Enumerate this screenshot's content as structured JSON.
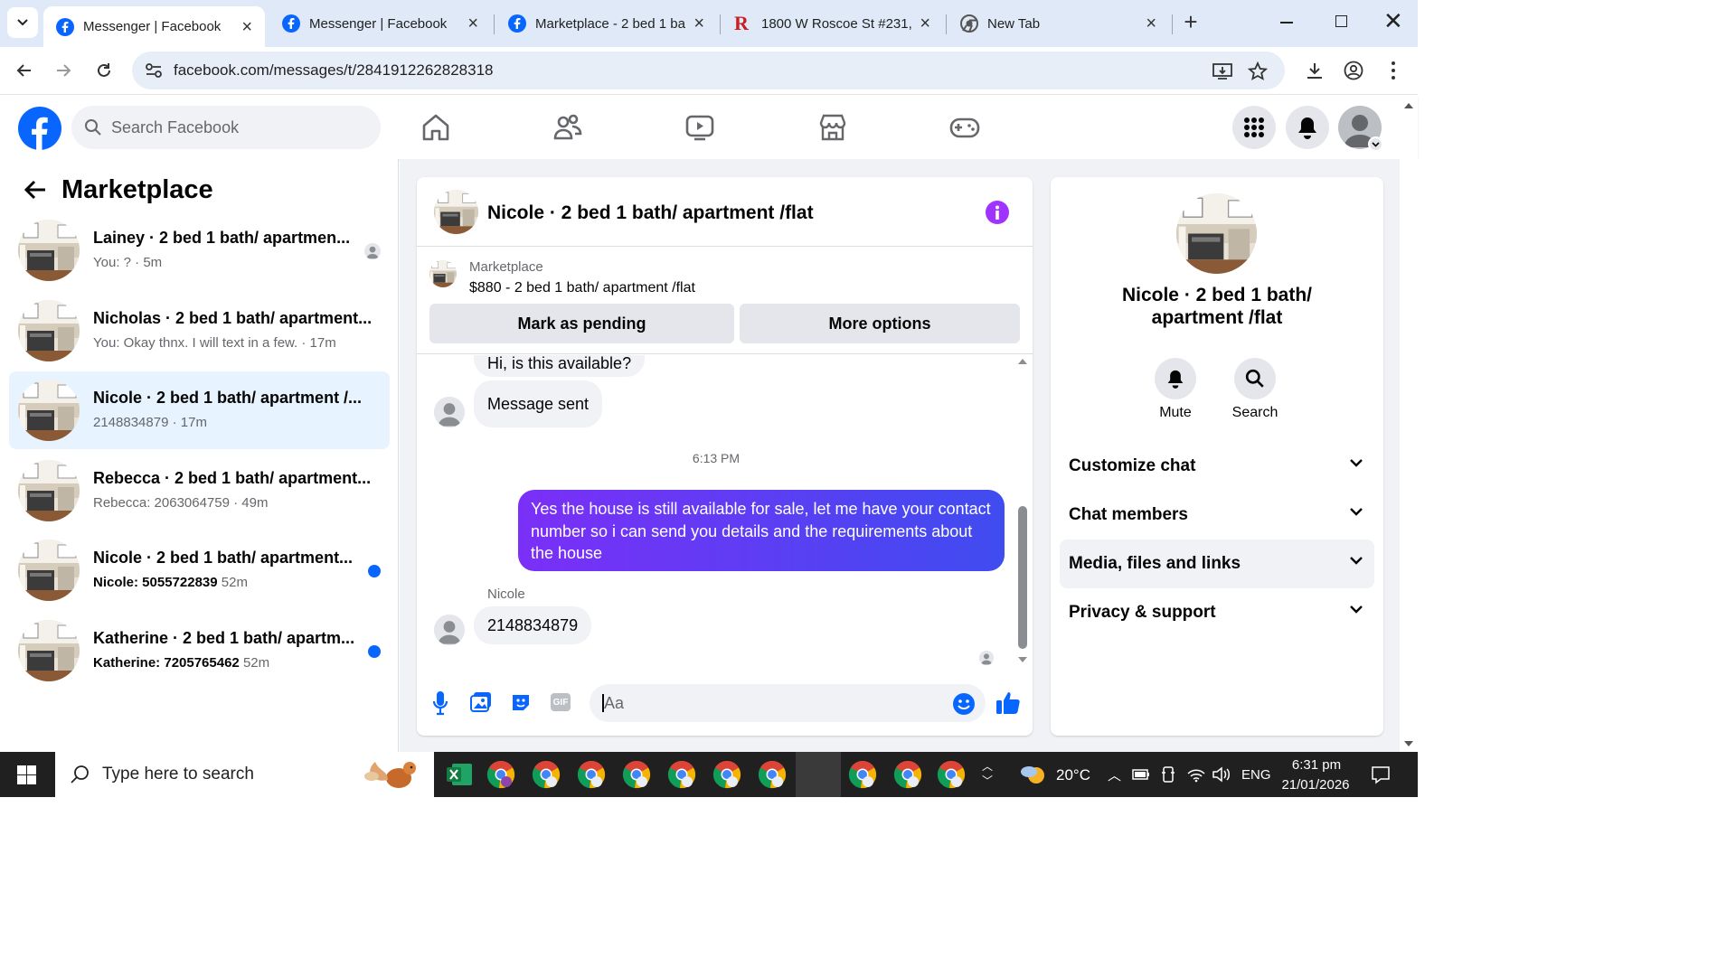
{
  "browser": {
    "tabs": [
      {
        "title": "Messenger | Facebook",
        "active": true,
        "icon": "facebook-icon"
      },
      {
        "title": "Messenger | Facebook",
        "active": false,
        "icon": "facebook-icon"
      },
      {
        "title": "Marketplace - 2 bed 1 ba",
        "active": false,
        "icon": "facebook-icon"
      },
      {
        "title": "1800 W Roscoe St #231, (",
        "active": false,
        "icon": "redfin-icon"
      },
      {
        "title": "New Tab",
        "active": false,
        "icon": "chrome-icon"
      }
    ],
    "url": "facebook.com/messages/t/2841912262828318"
  },
  "facebook": {
    "search_placeholder": "Search Facebook",
    "brand_color": "#0866ff"
  },
  "sidebar": {
    "title": "Marketplace",
    "conversations": [
      {
        "name": "Lainey · 2 bed 1 bath/ apartmen...",
        "preview": "You: ? · 5m",
        "unread": false,
        "selected": false,
        "status": "seen-avatar"
      },
      {
        "name": "Nicholas · 2 bed 1 bath/ apartment...",
        "preview": "You: Okay thnx. I will text in a few. · 17m",
        "unread": false,
        "selected": false,
        "status": ""
      },
      {
        "name": "Nicole · 2 bed 1 bath/ apartment /...",
        "preview": "2148834879 · 17m",
        "unread": false,
        "selected": true,
        "status": ""
      },
      {
        "name": "Rebecca · 2 bed 1 bath/ apartment...",
        "preview": "Rebecca: 2063064759 · 49m",
        "unread": false,
        "selected": false,
        "status": ""
      },
      {
        "name": "Nicole · 2 bed 1 bath/ apartment...",
        "preview": "Nicole: 5055722839",
        "time": "52m",
        "unread": true,
        "selected": false,
        "status": "unread-dot"
      },
      {
        "name": "Katherine · 2 bed 1 bath/ apartm...",
        "preview": "Katherine: 7205765462",
        "time": "52m",
        "unread": true,
        "selected": false,
        "status": "unread-dot"
      }
    ]
  },
  "chat": {
    "header_title": "Nicole · 2 bed 1 bath/ apartment /flat",
    "listing": {
      "label": "Marketplace",
      "title": "$880 - 2 bed 1 bath/ apartment /flat",
      "mark_pending": "Mark as pending",
      "more_options": "More options"
    },
    "messages": {
      "partial_incoming": "Hi, is this available?",
      "system": "Message sent",
      "timestamp": "6:13 PM",
      "outgoing": "Yes the house is still available for sale, let me have your contact number so i can send you details and the requirements about the house",
      "sender_name": "Nicole",
      "incoming": "2148834879"
    },
    "composer_placeholder": "Aa",
    "accent_gradient_start": "#7b2ff7",
    "accent_gradient_end": "#3f4cf0"
  },
  "details": {
    "name": "Nicole · 2 bed 1 bath/ apartment /flat",
    "mute_label": "Mute",
    "search_label": "Search",
    "sections": [
      "Customize chat",
      "Chat members",
      "Media, files and links",
      "Privacy & support"
    ]
  },
  "taskbar": {
    "search_placeholder": "Type here to search",
    "weather": "20°C",
    "language": "ENG",
    "time": "6:31 pm",
    "date": "21/01/2026"
  }
}
